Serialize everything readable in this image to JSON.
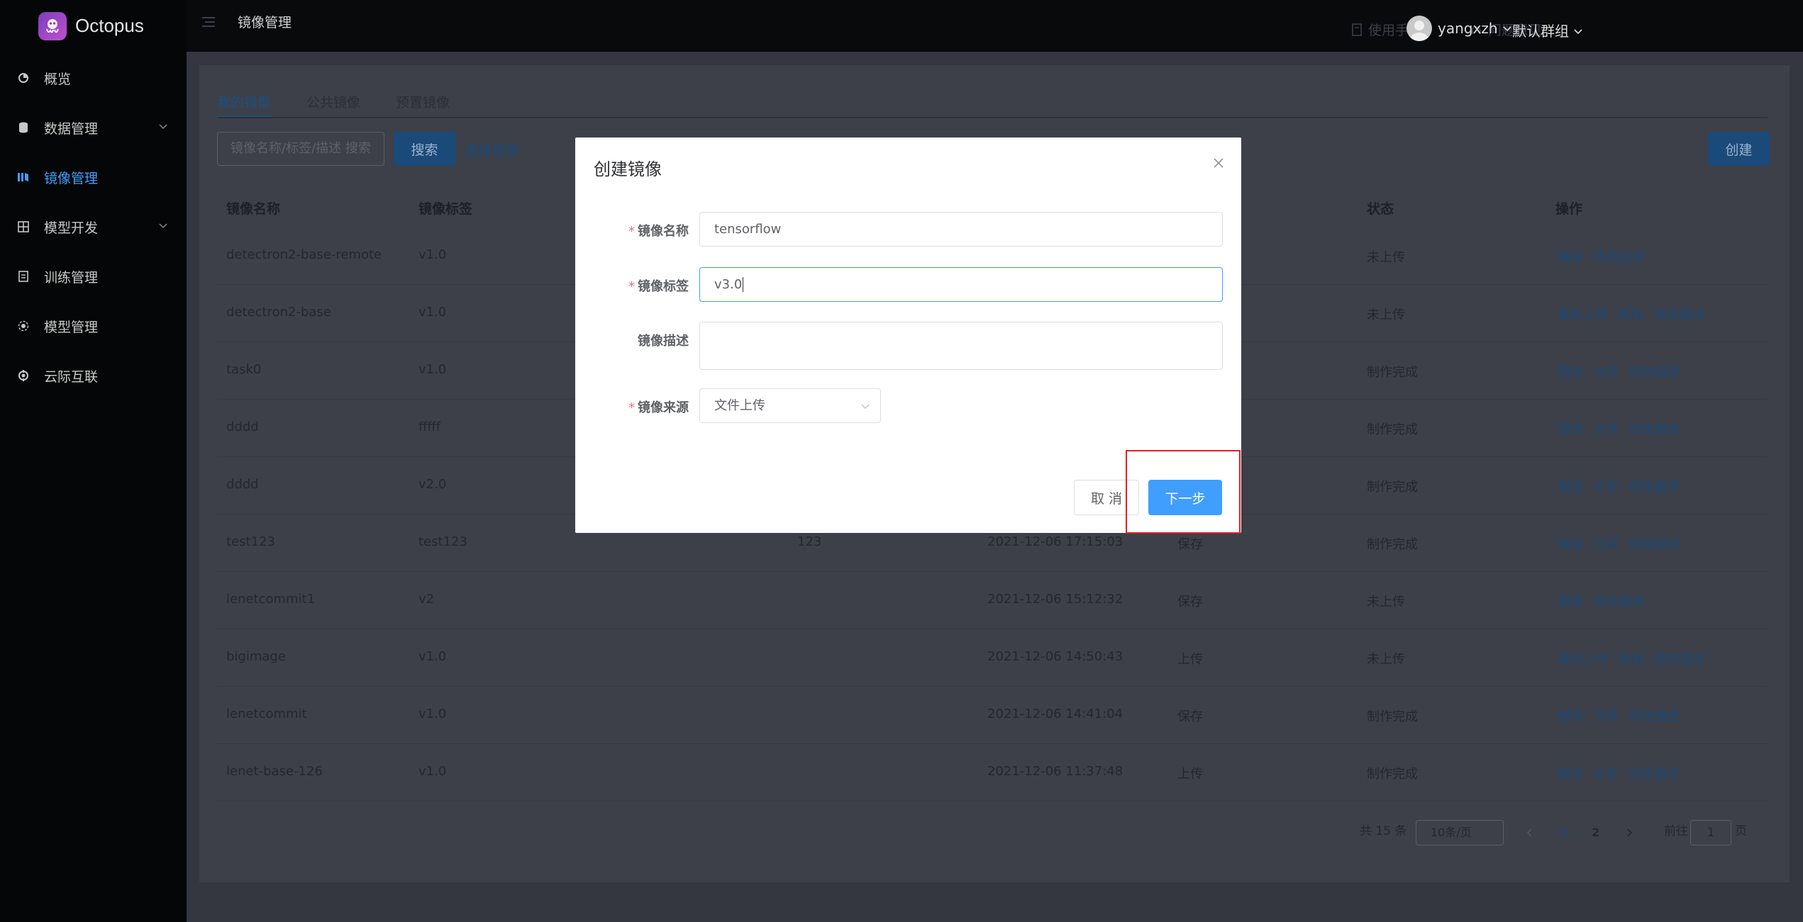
{
  "brand": {
    "name": "Octopus"
  },
  "sidebar": {
    "items": [
      {
        "label": "概览",
        "icon": "dashboard-icon",
        "active": false
      },
      {
        "label": "数据管理",
        "icon": "database-icon",
        "active": false,
        "expandable": true
      },
      {
        "label": "镜像管理",
        "icon": "image-icon",
        "active": true
      },
      {
        "label": "模型开发",
        "icon": "grid-icon",
        "active": false,
        "expandable": true
      },
      {
        "label": "训练管理",
        "icon": "document-icon",
        "active": false
      },
      {
        "label": "模型管理",
        "icon": "cube-icon",
        "active": false
      },
      {
        "label": "云际互联",
        "icon": "network-icon",
        "active": false
      }
    ]
  },
  "topbar": {
    "title": "镜像管理",
    "manual": "使用手册",
    "feedback": "问题意见",
    "user": "yangxzh",
    "group": "默认群组"
  },
  "tabs": [
    {
      "label": "我的镜像",
      "active": true
    },
    {
      "label": "公共镜像",
      "active": false
    },
    {
      "label": "预置镜像",
      "active": false
    }
  ],
  "search": {
    "placeholder": "镜像名称/标签/描述 搜索",
    "button": "搜索",
    "advanced": "高级搜索",
    "create": "创建"
  },
  "table": {
    "headers": [
      "镜像名称",
      "镜像标签",
      "状态",
      "操作"
    ],
    "rows": [
      {
        "name": "detectron2-base-remote",
        "tag": "v1.0",
        "desc": "",
        "time": "",
        "source": "",
        "status": "未上传",
        "ops": [
          "删除",
          "修改描述"
        ]
      },
      {
        "name": "detectron2-base",
        "tag": "v1.0",
        "desc": "",
        "time": "",
        "source": "",
        "status": "未上传",
        "ops": [
          "重新上传",
          "删除",
          "修改描述"
        ]
      },
      {
        "name": "task0",
        "tag": "v1.0",
        "desc": "",
        "time": "",
        "source": "",
        "status": "制作完成",
        "ops": [
          "删除",
          "分享",
          "修改描述"
        ]
      },
      {
        "name": "dddd",
        "tag": "fffff",
        "desc": "",
        "time": "",
        "source": "",
        "status": "制作完成",
        "ops": [
          "删除",
          "分享",
          "修改描述"
        ]
      },
      {
        "name": "dddd",
        "tag": "v2.0",
        "desc": "",
        "time": "",
        "source": "",
        "status": "制作完成",
        "ops": [
          "删除",
          "分享",
          "修改描述"
        ]
      },
      {
        "name": "test123",
        "tag": "test123",
        "desc": "123",
        "time": "2021-12-06 17:15:03",
        "source": "保存",
        "status": "制作完成",
        "ops": [
          "删除",
          "分享",
          "修改描述"
        ]
      },
      {
        "name": "lenetcommit1",
        "tag": "v2",
        "desc": "",
        "time": "2021-12-06 15:12:32",
        "source": "保存",
        "status": "未上传",
        "ops": [
          "删除",
          "修改描述"
        ]
      },
      {
        "name": "bigimage",
        "tag": "v1.0",
        "desc": "",
        "time": "2021-12-06 14:50:43",
        "source": "上传",
        "status": "未上传",
        "ops": [
          "重新上传",
          "删除",
          "修改描述"
        ]
      },
      {
        "name": "lenetcommit",
        "tag": "v1.0",
        "desc": "",
        "time": "2021-12-06 14:41:04",
        "source": "保存",
        "status": "制作完成",
        "ops": [
          "删除",
          "分享",
          "修改描述"
        ]
      },
      {
        "name": "lenet-base-126",
        "tag": "v1.0",
        "desc": "",
        "time": "2021-12-06 11:37:48",
        "source": "上传",
        "status": "制作完成",
        "ops": [
          "删除",
          "分享",
          "修改描述"
        ]
      }
    ]
  },
  "pagination": {
    "total": "共 15 条",
    "page_size": "10条/页",
    "pages": [
      "1",
      "2"
    ],
    "goto_prefix": "前往",
    "goto_value": "1",
    "goto_suffix": "页"
  },
  "modal": {
    "title": "创建镜像",
    "fields": {
      "name_label": "镜像名称",
      "name_value": "tensorflow",
      "tag_label": "镜像标签",
      "tag_value": "v3.0",
      "desc_label": "镜像描述",
      "source_label": "镜像来源",
      "source_value": "文件上传"
    },
    "cancel": "取 消",
    "next": "下一步"
  },
  "colors": {
    "primary": "#409eff",
    "required": "#f56c6c",
    "highlight": "#e02020"
  }
}
